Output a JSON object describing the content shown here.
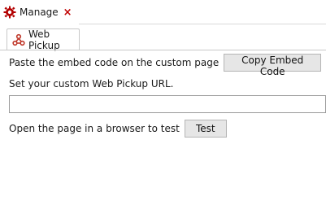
{
  "tabs": {
    "main": {
      "label": "Manage",
      "icon": "gear-icon",
      "close_glyph": "×",
      "close_color": "#c00000",
      "icon_color": "#b30000"
    },
    "sub": {
      "label": "Web Pickup",
      "icon": "web-pickup-icon",
      "icon_color": "#c0392b"
    }
  },
  "content": {
    "embed_text": "Paste the embed code on the custom page",
    "copy_button_label": "Copy Embed Code",
    "url_prompt": "Set your custom Web Pickup URL.",
    "url_value": "",
    "url_placeholder": "",
    "test_text": "Open the page in a browser to test",
    "test_button_label": "Test"
  }
}
